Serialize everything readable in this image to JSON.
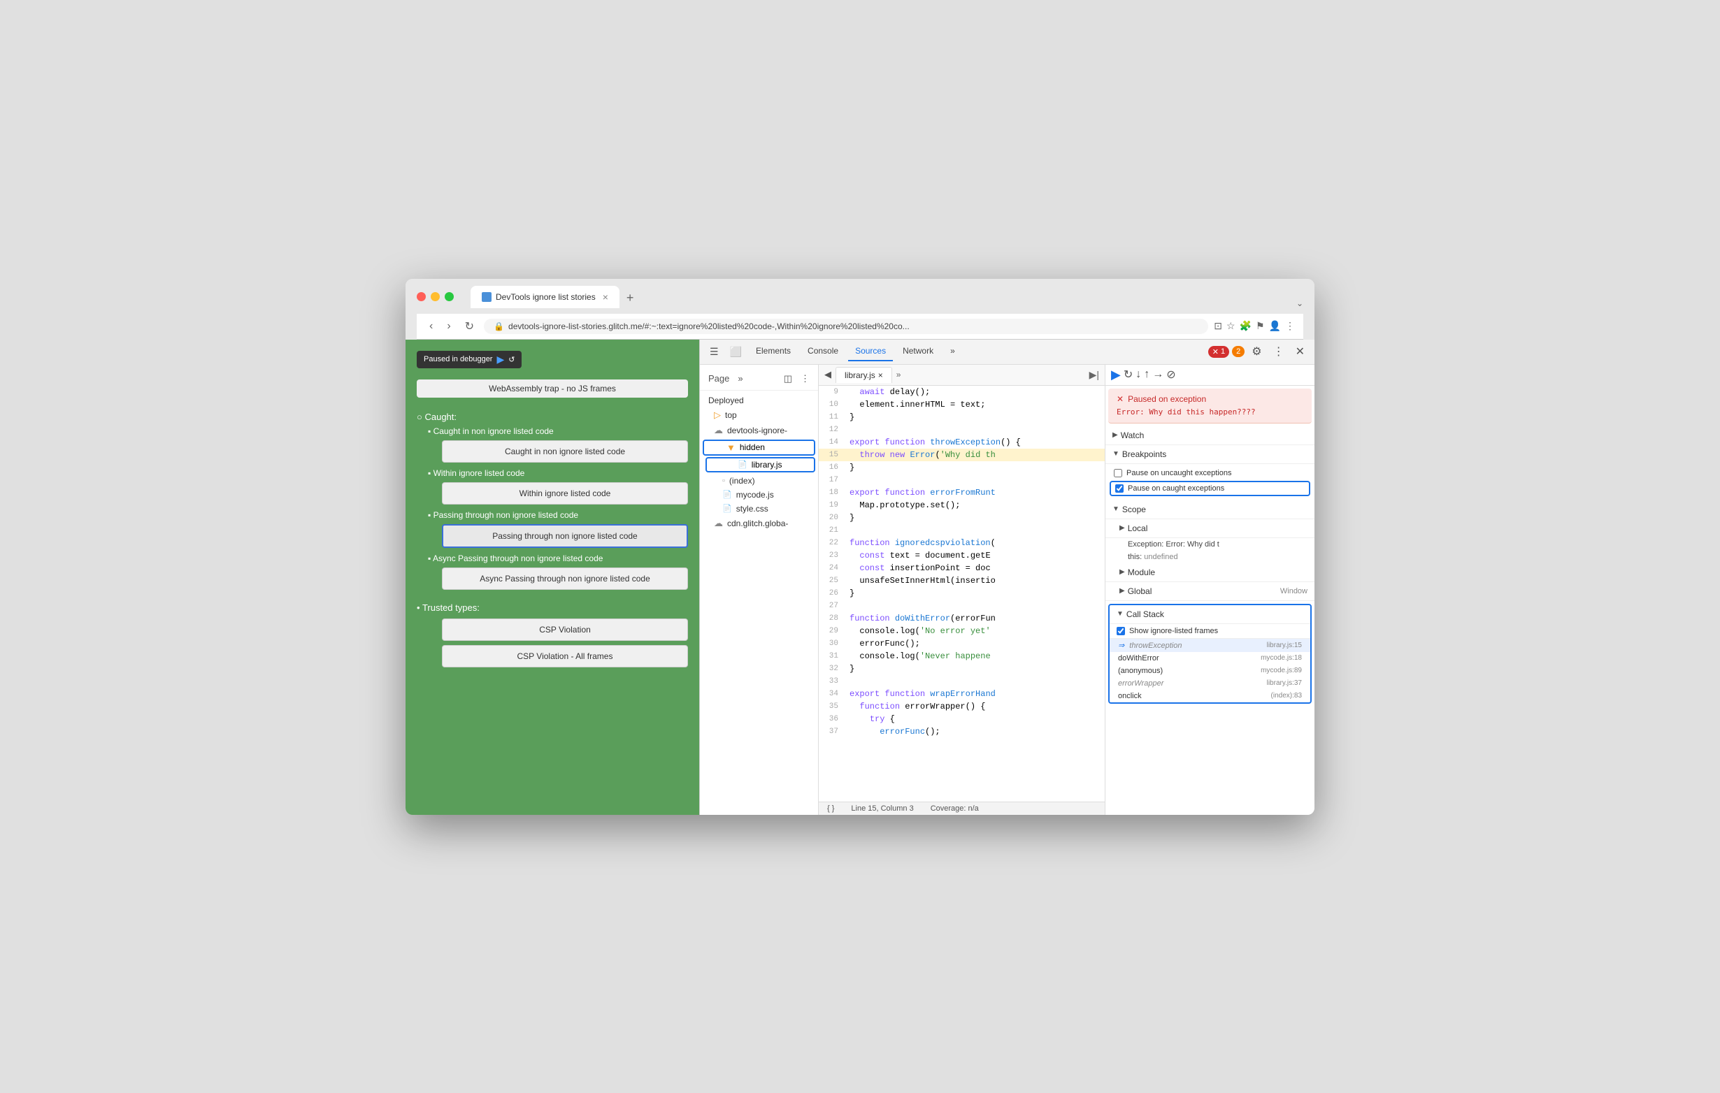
{
  "window": {
    "title": "DevTools ignore list stories",
    "tab_label": "DevTools ignore list stories",
    "tab_close": "×",
    "tab_add": "+",
    "tab_more": "⌄"
  },
  "address_bar": {
    "url": "devtools-ignore-list-stories.glitch.me/#:~:text=ignore%20listed%20code-,Within%20ignore%20listed%20co..."
  },
  "page": {
    "paused_badge": "Paused in debugger",
    "webassembly_item": "WebAssembly trap - no JS frames",
    "caught_label": "Caught:",
    "caught_items": [
      {
        "label": "Caught in non ignore listed code"
      },
      {
        "label": "Within ignore listed code"
      },
      {
        "label": "Passing through non ignore listed code"
      },
      {
        "label": "Async Passing through non ignore listed code"
      }
    ],
    "caught_buttons": [
      {
        "label": "Caught in non ignore listed code",
        "selected": false
      },
      {
        "label": "Within ignore listed code",
        "selected": false
      },
      {
        "label": "Passing through non ignore listed code",
        "selected": true
      },
      {
        "label": "Async Passing through non ignore listed code",
        "selected": false
      }
    ],
    "trusted_types_label": "Trusted types:",
    "csp_violation": "CSP Violation",
    "csp_violation_all": "CSP Violation - All frames"
  },
  "devtools": {
    "toolbar_icons": [
      "☰",
      "⬜"
    ],
    "tabs": [
      "Elements",
      "Console",
      "Sources",
      "Network",
      "»"
    ],
    "active_tab": "Sources",
    "error_count": "1",
    "warn_count": "2",
    "settings_icon": "⚙",
    "more_icon": "⋮",
    "close_icon": "✕"
  },
  "file_tree": {
    "nav_icons": [
      "◫",
      "⬛"
    ],
    "more_icon": "⋮",
    "page_label": "Page",
    "page_more": "»",
    "items": [
      {
        "label": "Deployed",
        "indent": 0,
        "type": "section"
      },
      {
        "label": "top",
        "indent": 1,
        "type": "folder"
      },
      {
        "label": "devtools-ignore-",
        "indent": 1,
        "type": "cloud",
        "expanded": true
      },
      {
        "label": "hidden",
        "indent": 2,
        "type": "folder",
        "highlighted": true
      },
      {
        "label": "library.js",
        "indent": 3,
        "type": "js",
        "highlighted": true
      },
      {
        "label": "(index)",
        "indent": 2,
        "type": "file"
      },
      {
        "label": "mycode.js",
        "indent": 2,
        "type": "js"
      },
      {
        "label": "style.css",
        "indent": 2,
        "type": "css"
      },
      {
        "label": "cdn.glitch.globa-",
        "indent": 1,
        "type": "cloud"
      }
    ]
  },
  "source_editor": {
    "tab_label": "library.js",
    "tab_close": "×",
    "lines": [
      {
        "num": 9,
        "code": "  await delay();",
        "highlight": false
      },
      {
        "num": 10,
        "code": "  element.innerHTML = text;",
        "highlight": false
      },
      {
        "num": 11,
        "code": "}",
        "highlight": false
      },
      {
        "num": 12,
        "code": "",
        "highlight": false
      },
      {
        "num": 14,
        "code": "export function throwException() {",
        "highlight": false
      },
      {
        "num": 15,
        "code": "  throw new Error('Why did th",
        "highlight": true
      },
      {
        "num": 16,
        "code": "}",
        "highlight": false
      },
      {
        "num": 17,
        "code": "",
        "highlight": false
      },
      {
        "num": 18,
        "code": "export function errorFromRunt",
        "highlight": false
      },
      {
        "num": 19,
        "code": "  Map.prototype.set();",
        "highlight": false
      },
      {
        "num": 20,
        "code": "}",
        "highlight": false
      },
      {
        "num": 21,
        "code": "",
        "highlight": false
      },
      {
        "num": 22,
        "code": "function ignoredcspviolation(",
        "highlight": false
      },
      {
        "num": 23,
        "code": "  const text = document.getE",
        "highlight": false
      },
      {
        "num": 24,
        "code": "  const insertionPoint = doc",
        "highlight": false
      },
      {
        "num": 25,
        "code": "  unsafeSetInnerHtml(insertio",
        "highlight": false
      },
      {
        "num": 26,
        "code": "}",
        "highlight": false
      },
      {
        "num": 27,
        "code": "",
        "highlight": false
      },
      {
        "num": 28,
        "code": "function doWithError(errorFun",
        "highlight": false
      },
      {
        "num": 29,
        "code": "  console.log('No error yet'",
        "highlight": false
      },
      {
        "num": 30,
        "code": "  errorFunc();",
        "highlight": false
      },
      {
        "num": 31,
        "code": "  console.log('Never happene",
        "highlight": false
      },
      {
        "num": 32,
        "code": "}",
        "highlight": false
      },
      {
        "num": 33,
        "code": "",
        "highlight": false
      },
      {
        "num": 34,
        "code": "export function wrapErrorHand",
        "highlight": false
      },
      {
        "num": 35,
        "code": "  function errorWrapper() {",
        "highlight": false
      },
      {
        "num": 36,
        "code": "    try {",
        "highlight": false
      },
      {
        "num": 37,
        "code": "      errorFunc();",
        "highlight": false
      }
    ],
    "status_line": "Line 15, Column 3",
    "status_coverage": "Coverage: n/a"
  },
  "right_panel": {
    "exception_title": "Paused on exception",
    "exception_msg": "Error: Why did this\nhappen????",
    "sections": {
      "watch": "Watch",
      "breakpoints": "Breakpoints",
      "scope": "Scope",
      "local": "Local",
      "module": "Module",
      "global": "Global",
      "call_stack": "Call Stack"
    },
    "breakpoints": {
      "pause_uncaught_label": "Pause on uncaught exceptions",
      "pause_caught_label": "Pause on caught exceptions",
      "pause_caught_checked": true,
      "pause_uncaught_checked": false
    },
    "scope": {
      "local_exception_key": "Exception:",
      "local_exception_val": "Error: Why did t",
      "this_key": "this:",
      "this_val": "undefined",
      "global_label": "Window"
    },
    "call_stack": {
      "show_ignore_label": "Show ignore-listed frames",
      "show_ignore_checked": true,
      "frames": [
        {
          "name": "throwException",
          "location": "library.js:15",
          "ignore": true,
          "active": true,
          "icon": "⇒"
        },
        {
          "name": "doWithError",
          "location": "mycode.js:18",
          "ignore": false,
          "active": false
        },
        {
          "name": "(anonymous)",
          "location": "mycode.js:89",
          "ignore": false,
          "active": false
        },
        {
          "name": "errorWrapper",
          "location": "library.js:37",
          "ignore": true,
          "active": false
        },
        {
          "name": "onclick",
          "location": "(index):83",
          "ignore": false,
          "active": false
        }
      ]
    }
  }
}
